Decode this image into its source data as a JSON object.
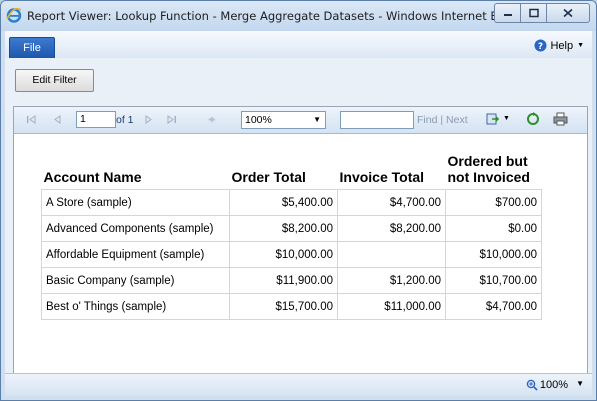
{
  "window": {
    "title": "Report Viewer: Lookup Function - Merge Aggregate Datasets - Windows Internet Explorer"
  },
  "menu": {
    "file_label": "File",
    "help_label": "Help"
  },
  "filter_button": "Edit Filter",
  "toolbar": {
    "page_value": "1",
    "of_label": "of 1",
    "zoom_value": "100%",
    "find_label": "Find",
    "find_sep": "|",
    "next_label": "Next"
  },
  "report": {
    "headers": [
      "Account Name",
      "Order Total",
      "Invoice Total",
      "Ordered but not Invoiced"
    ],
    "rows": [
      [
        "A Store (sample)",
        "$5,400.00",
        "$4,700.00",
        "$700.00"
      ],
      [
        "Advanced Components (sample)",
        "$8,200.00",
        "$8,200.00",
        "$0.00"
      ],
      [
        "Affordable Equipment (sample)",
        "$10,000.00",
        "",
        "$10,000.00"
      ],
      [
        "Basic Company (sample)",
        "$11,900.00",
        "$1,200.00",
        "$10,700.00"
      ],
      [
        "Best o' Things (sample)",
        "$15,700.00",
        "$11,000.00",
        "$4,700.00"
      ]
    ]
  },
  "status": {
    "zoom": "100%"
  },
  "icons": {
    "browser": "ie-icon",
    "help": "help-icon",
    "first": "first-page-icon",
    "prev": "prev-page-icon",
    "next": "next-page-icon",
    "last": "last-page-icon",
    "back": "back-to-parent-icon",
    "export": "export-icon",
    "refresh": "refresh-icon",
    "print": "print-icon",
    "zoom": "zoom-icon"
  },
  "colors": {
    "accent": "#1d56ad",
    "toolbar_text": "#1a3c72"
  }
}
